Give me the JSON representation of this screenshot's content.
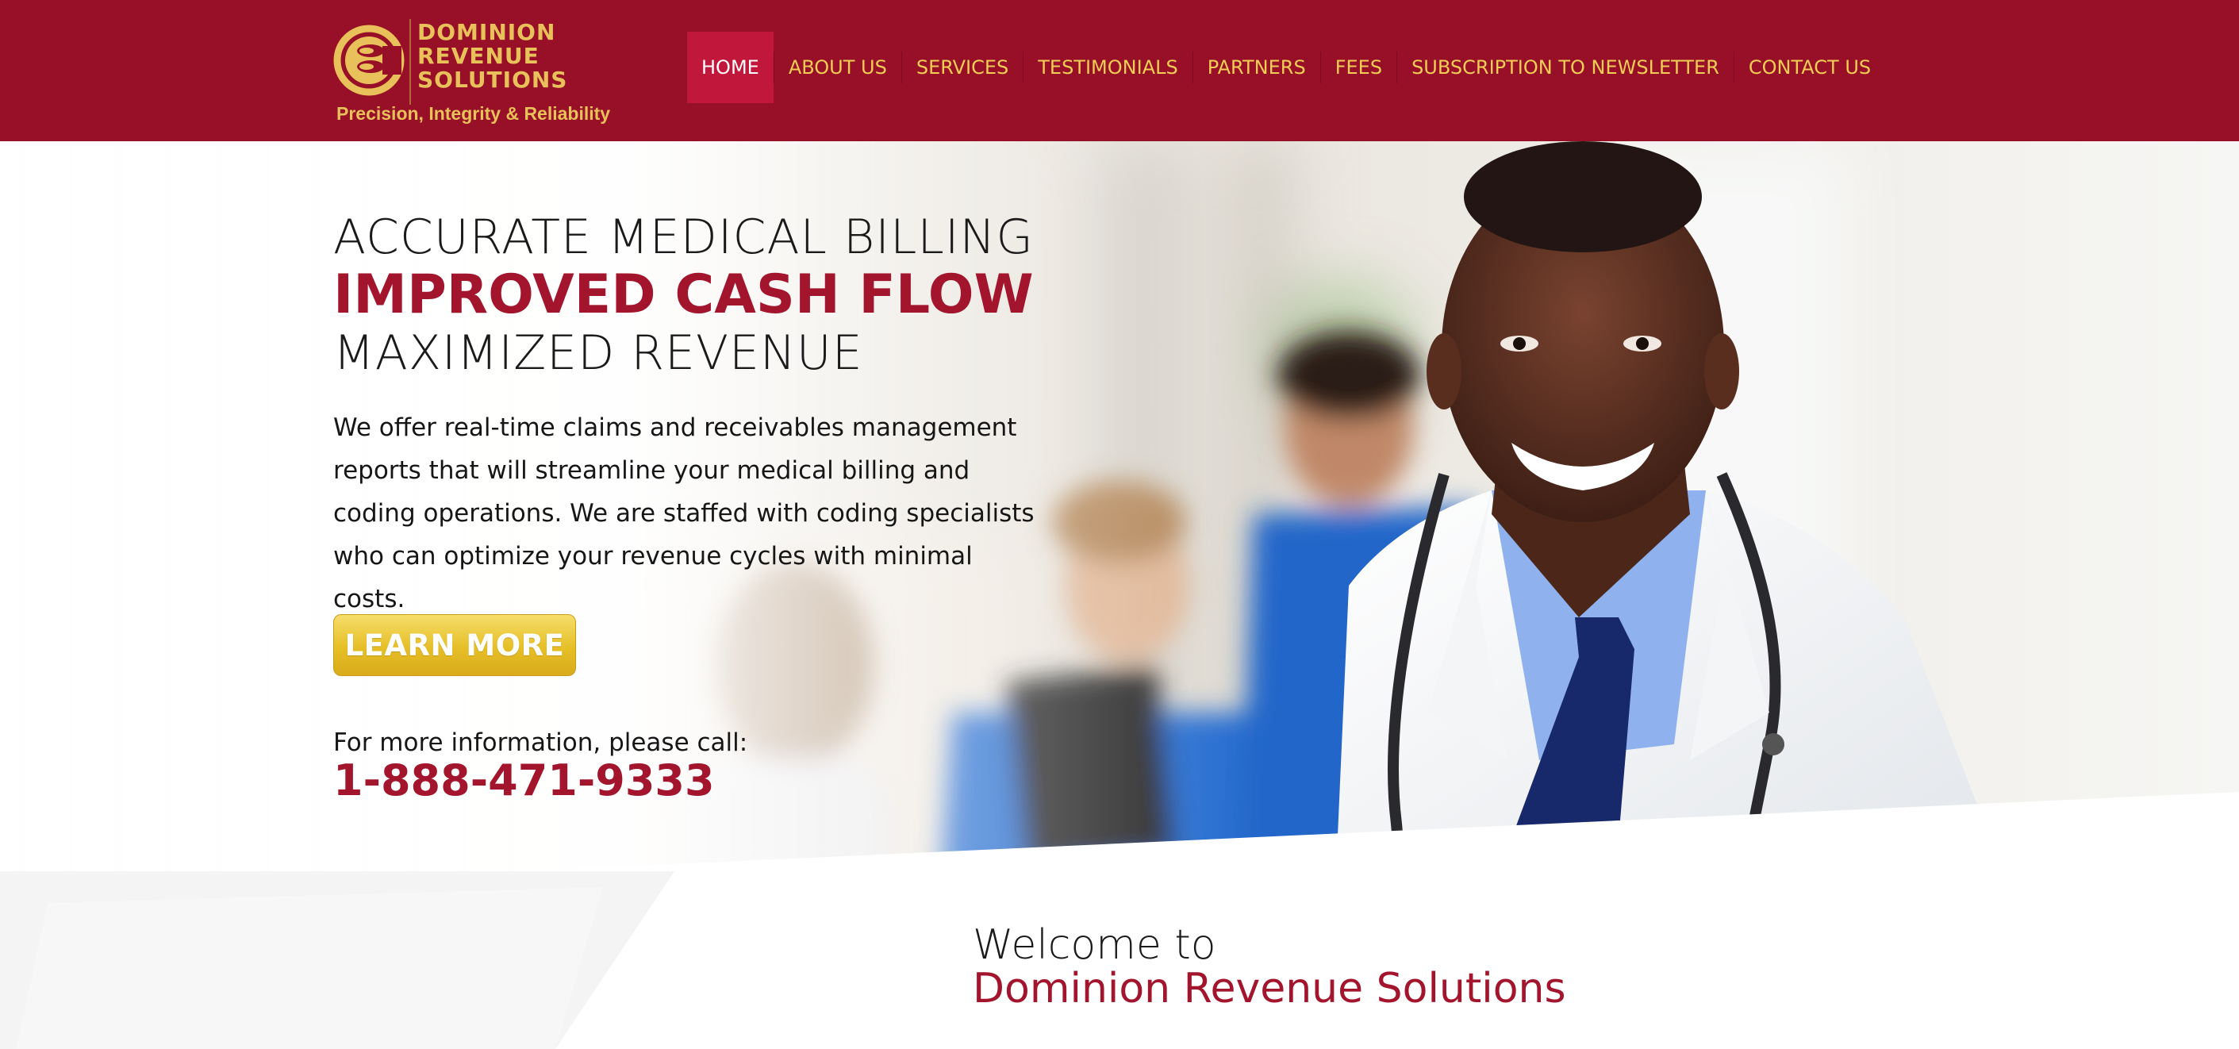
{
  "brand": {
    "name": "DOMINION\nREVENUE\nSOLUTIONS",
    "tagline": "Precision, Integrity & Reliability",
    "logo_icon": "dr-emblem-icon",
    "colors": {
      "primary": "#971027",
      "accent": "#e8c15a",
      "active_nav": "#c1173a",
      "headline_red": "#a3142d",
      "button_gold": "#e6bf27"
    }
  },
  "nav": {
    "items": [
      {
        "label": "HOME",
        "active": true
      },
      {
        "label": "ABOUT US",
        "active": false
      },
      {
        "label": "SERVICES",
        "active": false
      },
      {
        "label": "TESTIMONIALS",
        "active": false
      },
      {
        "label": "PARTNERS",
        "active": false
      },
      {
        "label": "FEES",
        "active": false
      },
      {
        "label": "SUBSCRIPTION TO NEWSLETTER",
        "active": false
      },
      {
        "label": "CONTACT US",
        "active": false
      }
    ]
  },
  "hero": {
    "line1": "ACCURATE MEDICAL BILLING",
    "line2": "IMPROVED CASH FLOW",
    "line3": "MAXIMIZED REVENUE",
    "intro": "We offer real-time claims and receivables management reports that will streamline your medical billing and coding operations. We are staffed with coding specialists who can optimize your revenue cycles with minimal costs.",
    "cta_label": "LEARN MORE",
    "call_label": "For more information, please call:",
    "phone": "1-888-471-9333"
  },
  "welcome": {
    "line1": "Welcome to",
    "line2": "Dominion Revenue Solutions"
  }
}
